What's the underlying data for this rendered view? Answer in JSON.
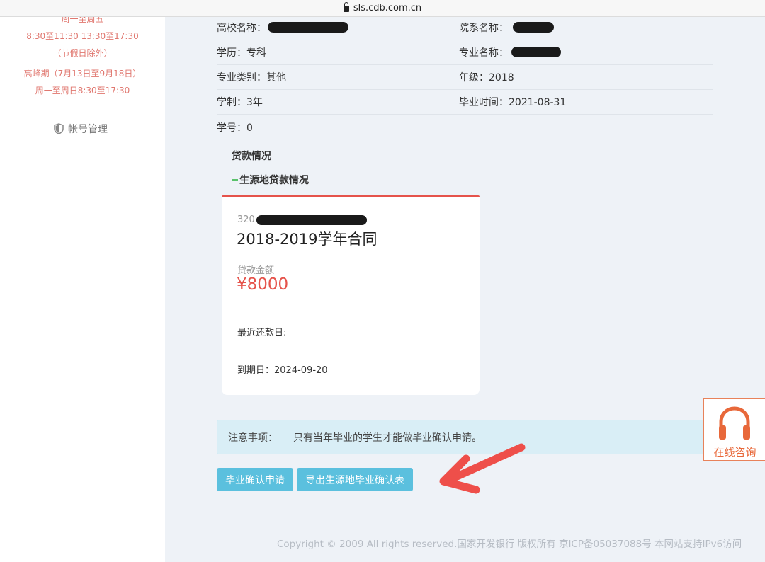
{
  "browser": {
    "url": "sls.cdb.com.cn"
  },
  "sidebar": {
    "service_hours": [
      "周一至周五",
      "8:30至11:30 13:30至17:30",
      "（节假日除外）",
      "高峰期（7月13日至9月18日）",
      "周一至周日8:30至17:30"
    ],
    "account_label": "帐号管理",
    "account_icon": "shield-icon"
  },
  "info": {
    "school_label": "高校名称：",
    "dept_label": "院系名称：",
    "degree_label": "学历：专科",
    "major_label": "专业名称：",
    "major_type": "专业类别：其他",
    "grade": "年级：2018",
    "duration": "学制：3年",
    "grad_time": "毕业时间：2021-08-31",
    "student_no": "学号：0"
  },
  "loan": {
    "section_title": "贷款情况",
    "sub_title": "生源地贷款情况",
    "contract_prefix": "320",
    "contract_title": "2018-2019学年合同",
    "amount_label": "贷款金额",
    "amount": "¥8000",
    "recent_repay": "最近还款日:",
    "due_date": "到期日：2024-09-20"
  },
  "notice": {
    "label": "注意事项：",
    "text": "只有当年毕业的学生才能做毕业确认申请。"
  },
  "buttons": {
    "apply": "毕业确认申请",
    "export": "导出生源地毕业确认表"
  },
  "footer": "Copyright © 2009 All rights reserved.国家开发银行 版权所有 京ICP备05037088号 本网站支持IPv6访问",
  "consult": {
    "label": "在线咨询",
    "icon": "headset-icon"
  },
  "colors": {
    "accent_red": "#e5534b",
    "button": "#5bc0de",
    "consult": "#e8683a"
  }
}
